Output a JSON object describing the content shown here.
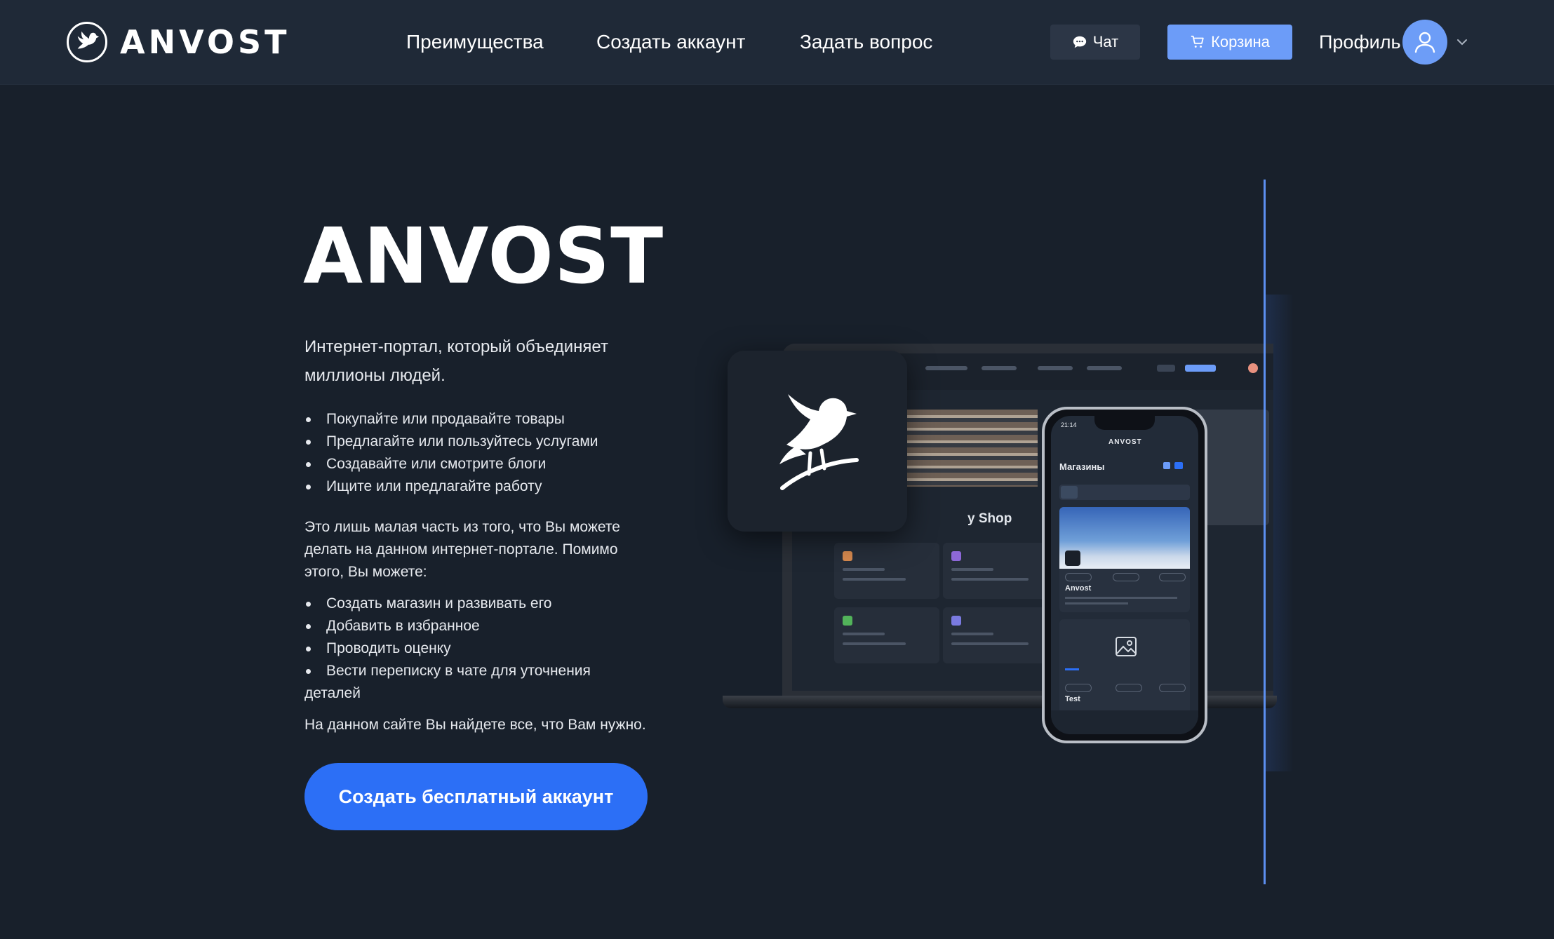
{
  "header": {
    "logo_text": "ANVOST",
    "nav": [
      {
        "label": "Преимущества"
      },
      {
        "label": "Создать аккаунт"
      },
      {
        "label": "Задать вопрос"
      }
    ],
    "chat_label": "Чат",
    "cart_label": "Корзина",
    "profile_label": "Профиль"
  },
  "hero": {
    "title": "ANVOST",
    "subtitle": "Интернет-портал, который объединяет миллионы людей.",
    "list1": [
      "Покупайте или продавайте товары",
      "Предлагайте или пользуйтесь услугами",
      "Создавайте или смотрите блоги",
      "Ищите или предлагайте работу"
    ],
    "paragraph1": "Это лишь малая часть из того, что Вы можете делать на данном интернет-портале. Помимо этого, Вы можете:",
    "list2": [
      "Создать магазин и развивать его",
      "Добавить в избранное",
      "Проводить оценку",
      "Вести переписку в чате для уточнения"
    ],
    "list2_last_line": "деталей",
    "paragraph2": "На данном сайте Вы найдете все, что Вам нужно.",
    "cta_label": "Создать бесплатный аккаунт"
  },
  "mockup": {
    "laptop_shop_text": "y Shop",
    "phone_time": "21:14",
    "phone_brand": "ANVOST",
    "phone_heading": "Магазины",
    "phone_card1_title": "Anvost",
    "phone_card2_title": "Test"
  },
  "colors": {
    "background": "#18202b",
    "header": "#1f2937",
    "cart_button": "#6c9cf8",
    "cta_button": "#2c6ff6",
    "accent_line": "#5c8ff0"
  }
}
